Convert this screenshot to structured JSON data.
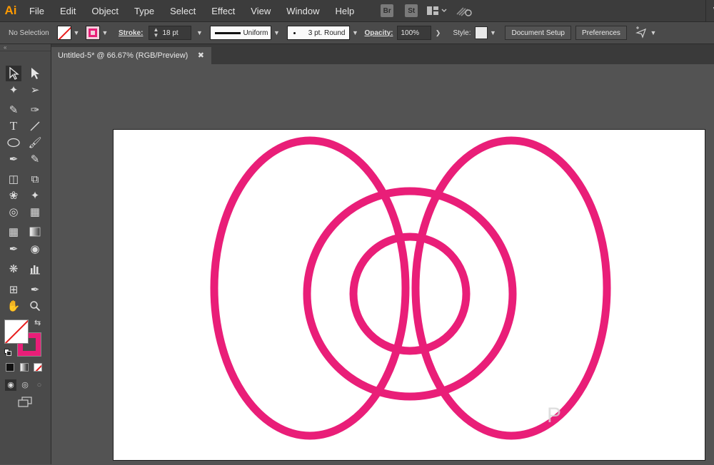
{
  "app": {
    "logo": "Ai"
  },
  "menu": [
    "File",
    "Edit",
    "Object",
    "Type",
    "Select",
    "Effect",
    "View",
    "Window",
    "Help"
  ],
  "menu_icons": {
    "bridge": "Br",
    "stock": "St"
  },
  "menu_overflow": "W",
  "control_bar": {
    "selection_label": "No Selection",
    "stroke_label": "Stroke:",
    "stroke_weight": "18 pt",
    "profile": "Uniform",
    "brush": "3 pt. Round",
    "opacity_label": "Opacity:",
    "opacity_value": "100%",
    "style_label": "Style:",
    "document_setup": "Document Setup",
    "preferences": "Preferences"
  },
  "document_tab": {
    "title": "Untitled-5* @ 66.67% (RGB/Preview)"
  },
  "colors": {
    "stroke": "#e91e78",
    "accent": "#ff9a00"
  },
  "artwork": {
    "shape": "ellipse",
    "stroke_color": "#e91e78",
    "stroke_weight": "18 pt",
    "count": 4
  }
}
